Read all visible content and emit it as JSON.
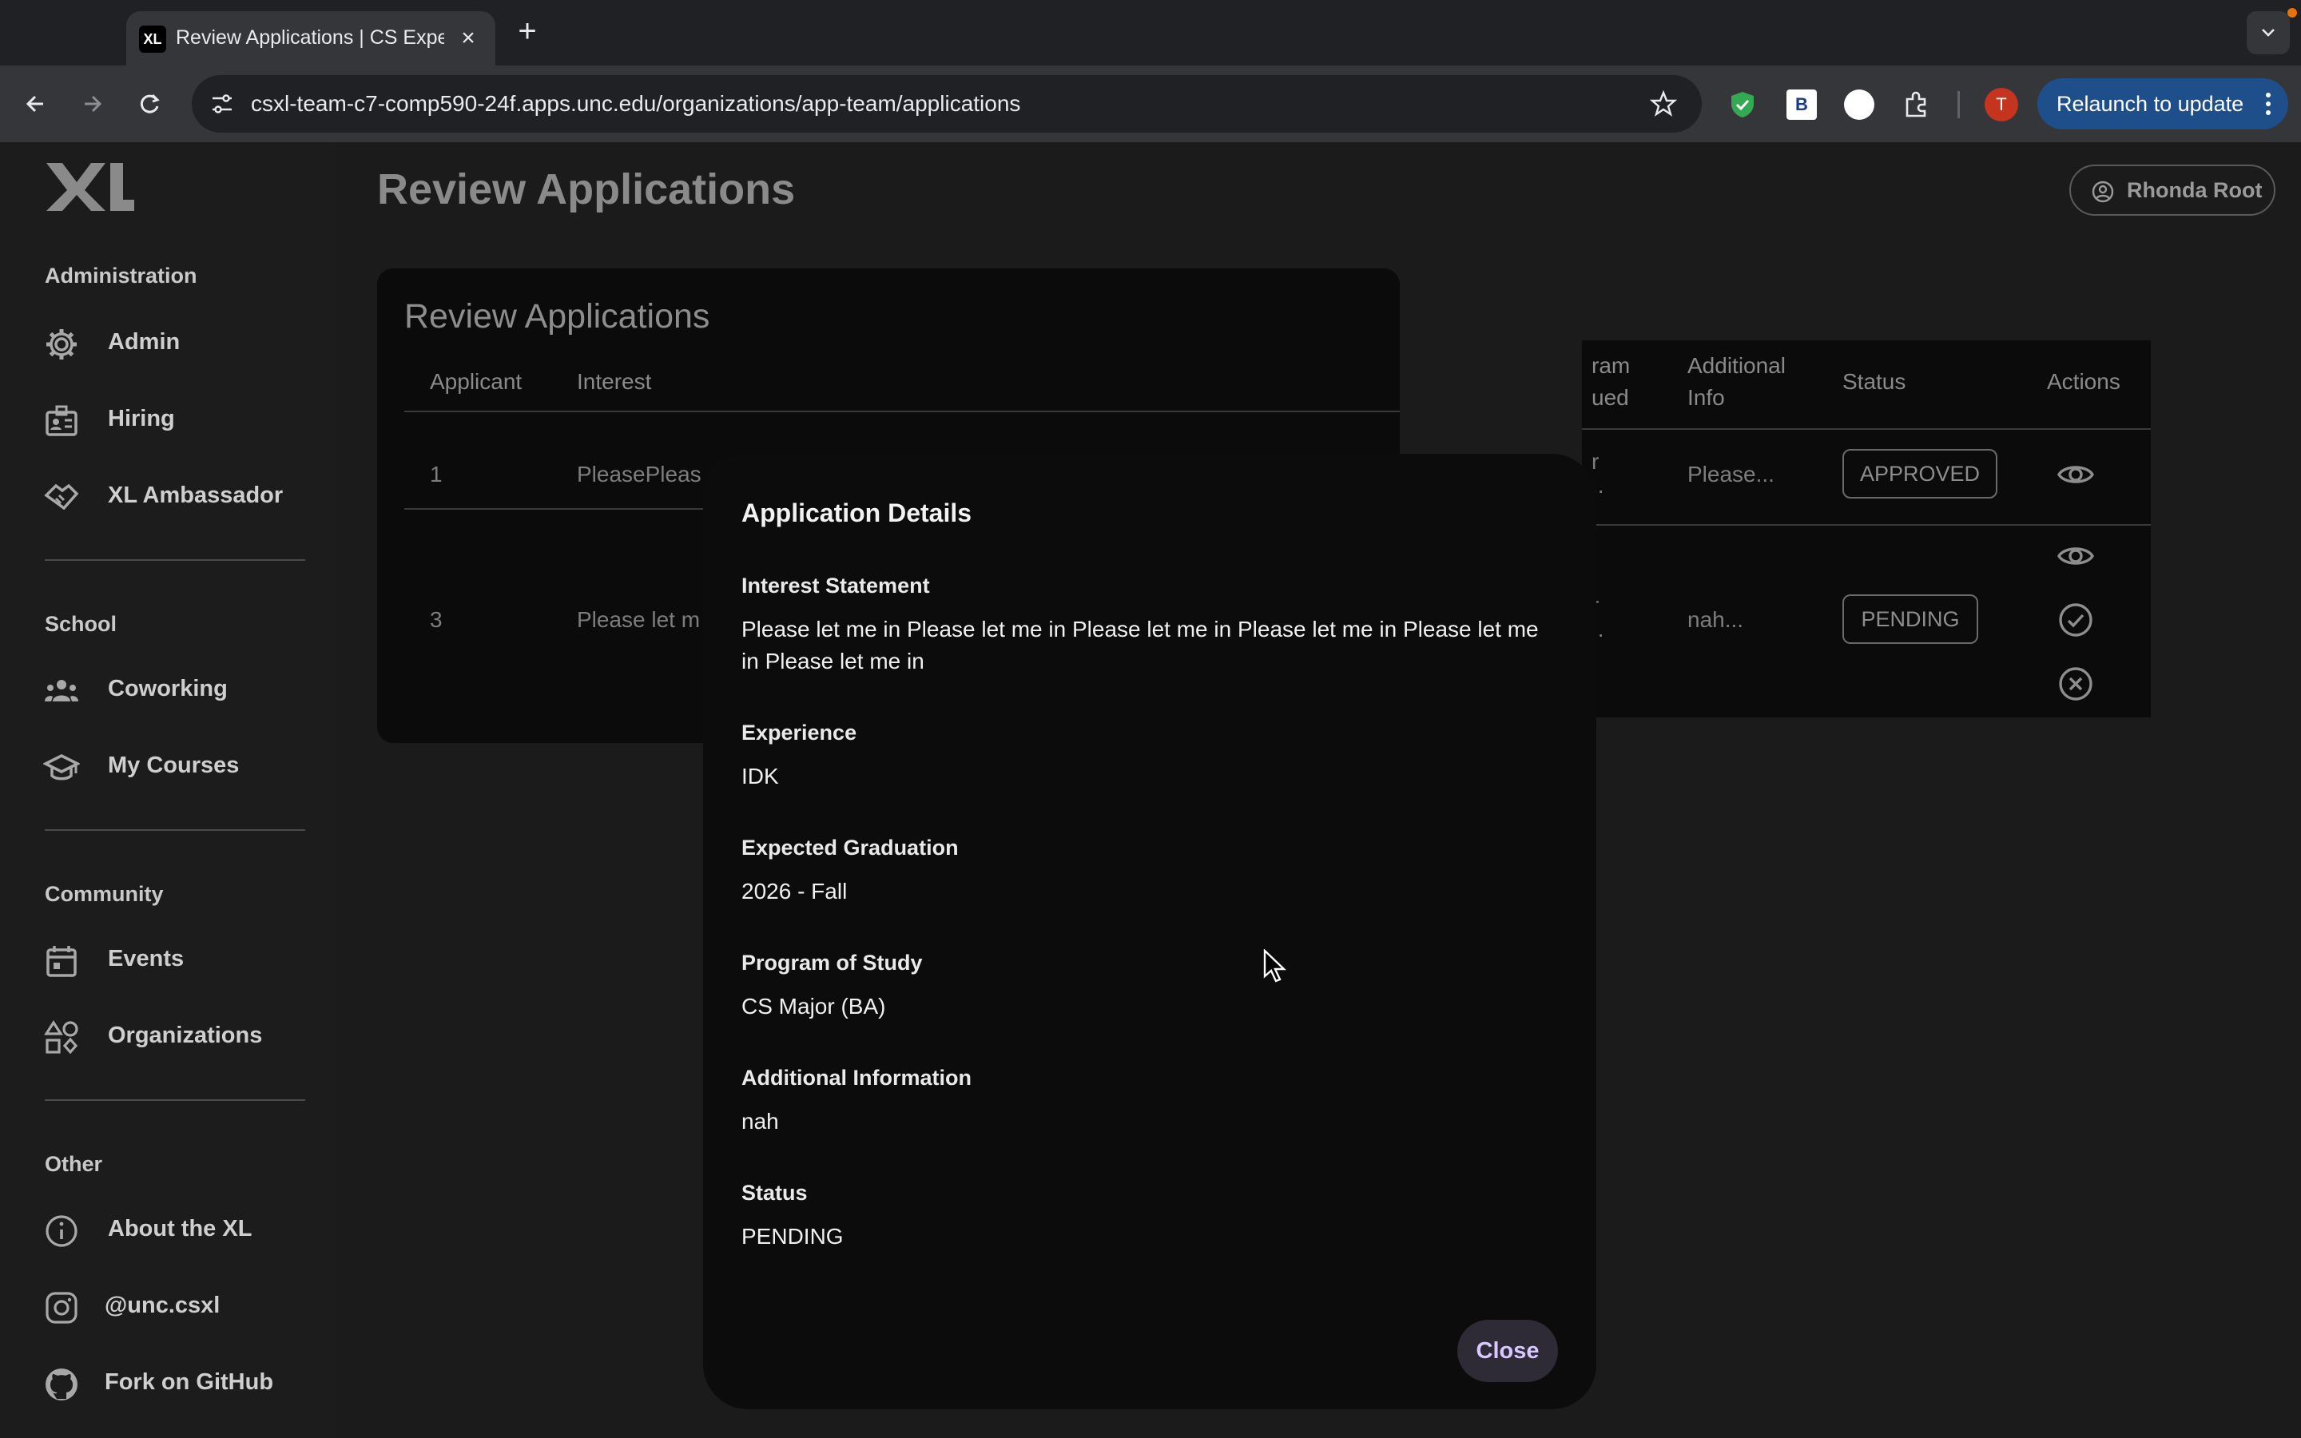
{
  "browser": {
    "tab_title": "Review Applications | CS Experience Labs",
    "tab_favicon_text": "XL",
    "new_tab_icon": "plus-icon",
    "url": "csxl-team-c7-comp590-24f.apps.unc.edu/organizations/app-team/applications",
    "profile_initial": "T",
    "relaunch_label": "Relaunch to update",
    "extension_b_label": "B"
  },
  "sidebar": {
    "sections": [
      {
        "title": "Administration",
        "items": [
          {
            "label": "Admin",
            "icon": "gear-icon"
          },
          {
            "label": "Hiring",
            "icon": "badge-icon"
          },
          {
            "label": "XL Ambassador",
            "icon": "handshake-icon"
          }
        ]
      },
      {
        "title": "School",
        "items": [
          {
            "label": "Coworking",
            "icon": "group-icon"
          },
          {
            "label": "My Courses",
            "icon": "graduation-cap-icon"
          }
        ]
      },
      {
        "title": "Community",
        "items": [
          {
            "label": "Events",
            "icon": "calendar-icon"
          },
          {
            "label": "Organizations",
            "icon": "category-icon"
          }
        ]
      },
      {
        "title": "Other",
        "items": [
          {
            "label": "About the XL",
            "icon": "info-icon"
          },
          {
            "label": "@unc.csxl",
            "icon": "instagram-icon"
          },
          {
            "label": "Fork on GitHub",
            "icon": "github-icon"
          }
        ]
      }
    ]
  },
  "header": {
    "page_title": "Review Applications",
    "user_name": "Rhonda Root"
  },
  "table": {
    "card_title": "Review Applications",
    "headers": {
      "applicant": "Applicant",
      "interest": "Interest",
      "program_line1": "ram",
      "program_line2": "ued",
      "additional_line1": "Additional",
      "additional_line2": "Info",
      "status": "Status",
      "actions": "Actions"
    },
    "rows": [
      {
        "applicant": "1",
        "interest": "PleasePleas",
        "program_a": "r",
        "program_b": "..",
        "additional": "Please...",
        "status": "APPROVED"
      },
      {
        "applicant": "3",
        "interest": "Please let m",
        "program_a": "r",
        "program_b": "..",
        "additional": "nah...",
        "status": "PENDING"
      }
    ]
  },
  "modal": {
    "title": "Application Details",
    "fields": [
      {
        "label": "Interest Statement",
        "value": "Please let me in Please let me in Please let me in Please let me in Please let me in Please let me in"
      },
      {
        "label": "Experience",
        "value": "IDK"
      },
      {
        "label": "Expected Graduation",
        "value": "2026 - Fall"
      },
      {
        "label": "Program of Study",
        "value": "CS Major (BA)"
      },
      {
        "label": "Additional Information",
        "value": "nah"
      },
      {
        "label": "Status",
        "value": "PENDING"
      }
    ],
    "close_label": "Close"
  },
  "colors": {
    "accent_button_text": "#d9c8ff",
    "relaunch_bg": "#1f4f8a",
    "profile_bg": "#c5341f",
    "shield_ext": "#34a853"
  }
}
